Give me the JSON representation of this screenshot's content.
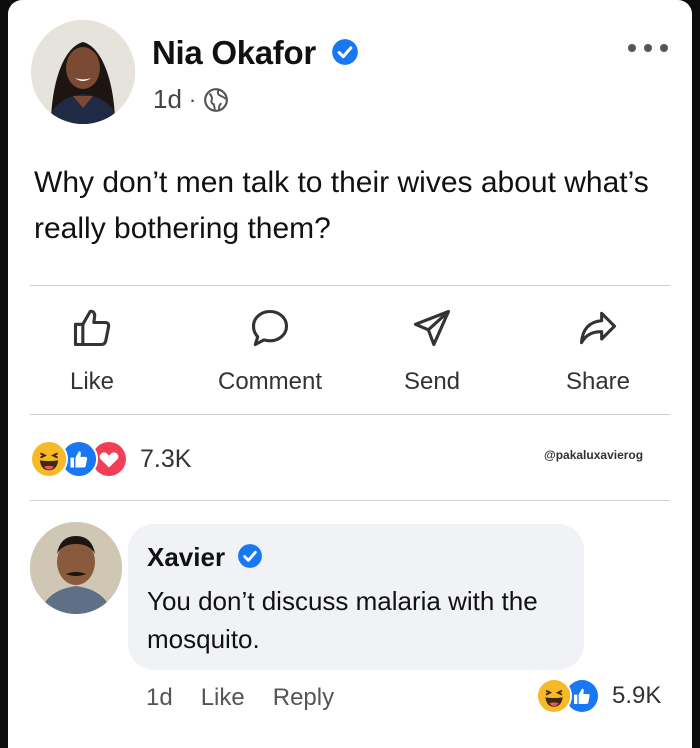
{
  "post": {
    "author": "Nia Okafor",
    "time": "1d",
    "separator": "·",
    "text": "Why don’t men talk to their wives about what’s really bothering them?",
    "reaction_count": "7.3K",
    "watermark": "@pakaluxavierog"
  },
  "actions": {
    "like": "Like",
    "comment": "Comment",
    "send": "Send",
    "share": "Share"
  },
  "comment": {
    "author": "Xavier",
    "text": "You don’t discuss malaria with the mosquito.",
    "time": "1d",
    "like": "Like",
    "reply": "Reply",
    "reaction_count": "5.9K"
  },
  "colors": {
    "verified": "#1877f2",
    "like_blue": "#1877f2",
    "love_red": "#f33e58",
    "haha_yellow": "#f7b928"
  },
  "icons": [
    "verified-badge-icon",
    "globe-icon",
    "more-icon",
    "like-icon",
    "comment-icon",
    "send-icon",
    "share-icon",
    "haha-reaction-icon",
    "like-reaction-icon",
    "love-reaction-icon"
  ]
}
